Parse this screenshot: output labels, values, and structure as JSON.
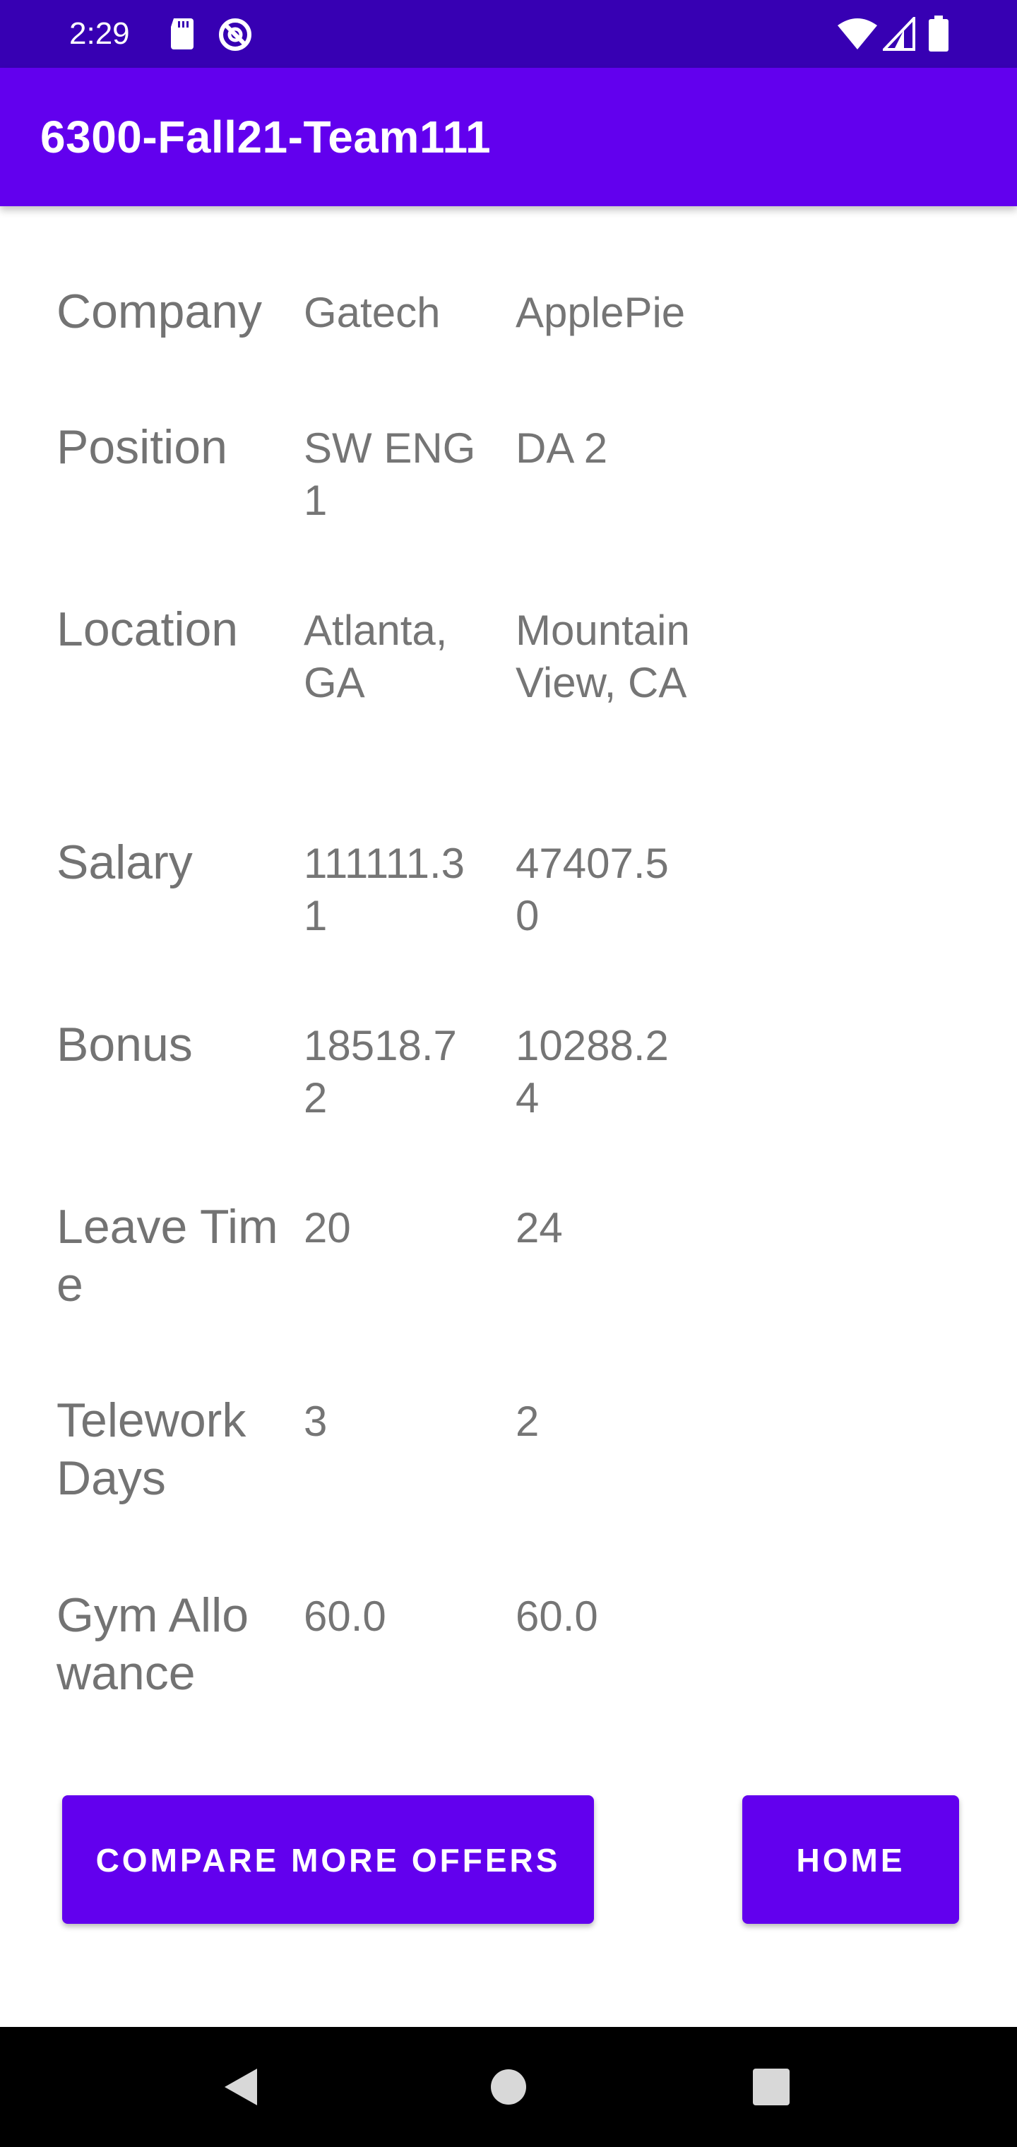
{
  "status_bar": {
    "time": "2:29",
    "icons": [
      "sd-card-icon",
      "do-not-disturb-icon",
      "wifi-icon",
      "signal-icon",
      "battery-icon"
    ],
    "color": "#3700b3"
  },
  "app_bar": {
    "title": "6300-Fall21-Team111",
    "color": "#6200ee"
  },
  "comparison": {
    "rows": [
      {
        "label": "Company",
        "offer1": "Gatech",
        "offer2": "ApplePie"
      },
      {
        "label": "Position",
        "offer1": "SW ENG 1",
        "offer2": "DA 2"
      },
      {
        "label": "Location",
        "offer1": "Atlanta, GA",
        "offer2": "Mountain View, CA"
      },
      {
        "label": "Salary",
        "offer1": "111111.31",
        "offer2": "47407.50"
      },
      {
        "label": "Bonus",
        "offer1": "18518.72",
        "offer2": "10288.24"
      },
      {
        "label": "Leave Time",
        "offer1": "20",
        "offer2": "24"
      },
      {
        "label": "Telework Days",
        "offer1": "3",
        "offer2": "2"
      },
      {
        "label": "Gym Allowance",
        "offer1": "60.0",
        "offer2": "60.0"
      }
    ]
  },
  "buttons": {
    "compare_more": "COMPARE MORE OFFERS",
    "home": "HOME"
  },
  "nav_bar": {
    "icons": [
      "back-icon",
      "home-icon",
      "recents-icon"
    ]
  }
}
